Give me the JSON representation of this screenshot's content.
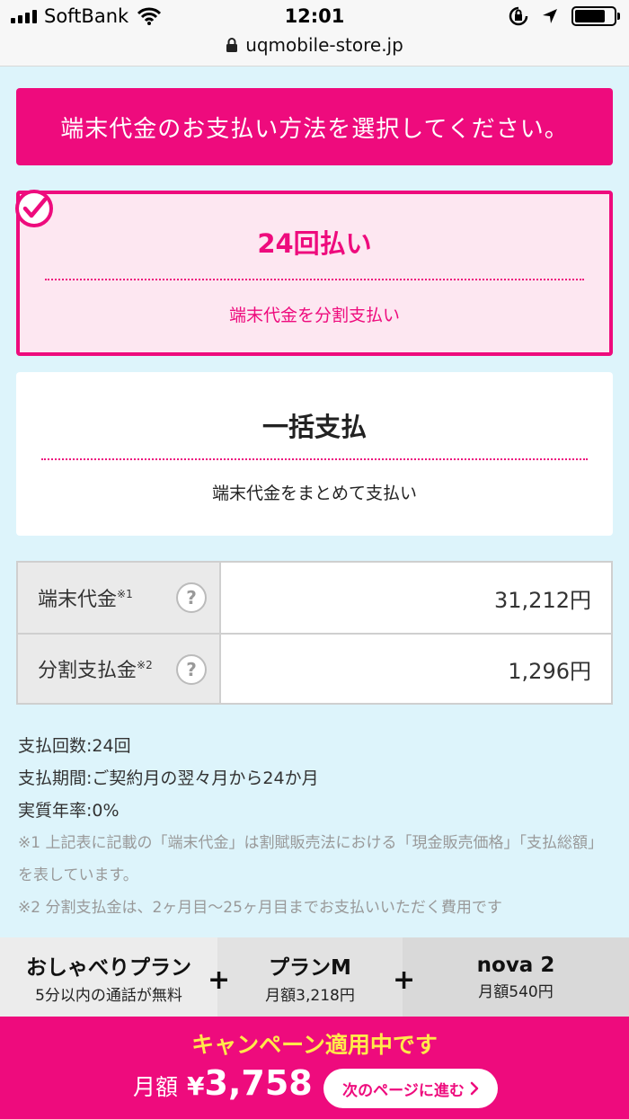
{
  "status_bar": {
    "carrier": "SoftBank",
    "time": "12:01",
    "url": "uqmobile-store.jp",
    "icons": [
      "signal-icon",
      "wifi-icon",
      "rotation-lock-icon",
      "location-arrow-icon",
      "battery-icon",
      "lock-icon"
    ]
  },
  "banner": {
    "text": "端末代金のお支払い方法を選択してください。"
  },
  "options": [
    {
      "title": "24回払い",
      "subtitle": "端末代金を分割支払い",
      "selected": true
    },
    {
      "title": "一括支払",
      "subtitle": "端末代金をまとめて支払い",
      "selected": false
    }
  ],
  "price_table": {
    "rows": [
      {
        "label": "端末代金",
        "note": "※1",
        "value": "31,212円"
      },
      {
        "label": "分割支払金",
        "note": "※2",
        "value": "1,296円"
      }
    ],
    "help_mark": "?"
  },
  "payment_info": {
    "count": "支払回数:24回",
    "period": "支払期間:ご契約月の翌々月から24か月",
    "apr": "実質年率:0%",
    "note1": "※1 上記表に記載の「端末代金」は割賦販売法における「現金販売価格」「支払総額」を表しています。",
    "note2": "※2 分割支払金は、2ヶ月目〜25ヶ月目までお支払いいただく費用です"
  },
  "plan_bar": {
    "items": [
      {
        "name": "おしゃべりプラン",
        "sub": "5分以内の通話が無料"
      },
      {
        "name": "プランM",
        "sub": "月額3,218円"
      },
      {
        "name": "nova 2",
        "sub": "月額540円"
      }
    ],
    "separator": "+"
  },
  "footer": {
    "campaign": "キャンペーン適用中です",
    "monthly_label": "月額",
    "currency": "¥",
    "amount": "3,758",
    "next_button": "次のページに進む"
  },
  "colors": {
    "accent": "#ee0b7d",
    "background": "#ddf4fb",
    "campaign_text": "#ffe94a"
  }
}
